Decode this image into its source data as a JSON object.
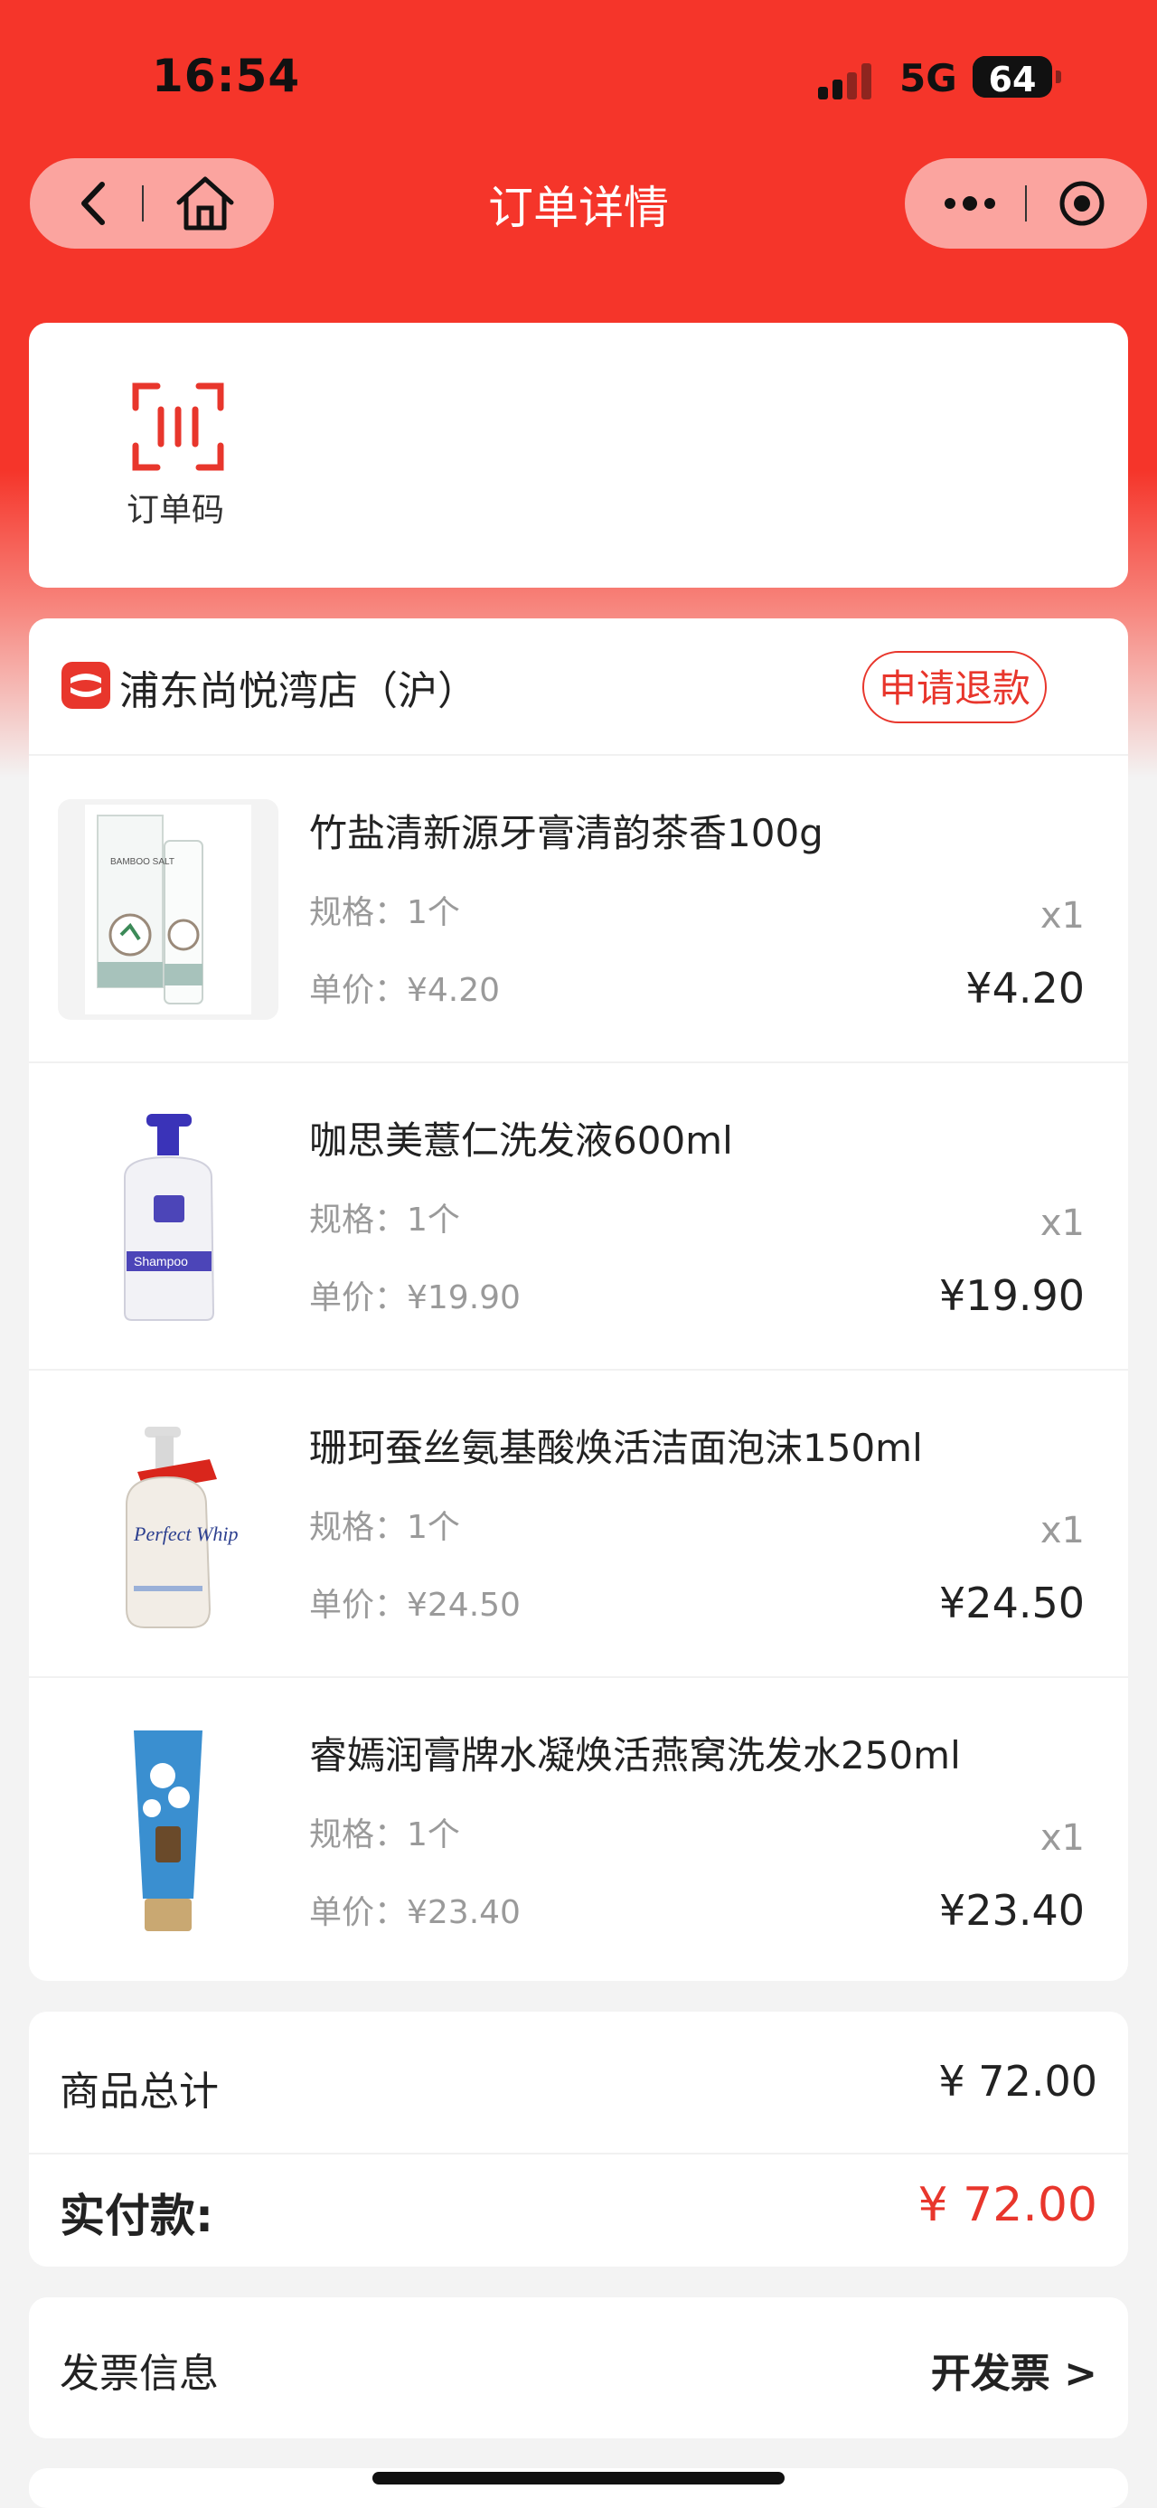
{
  "status_bar": {
    "time": "16:54",
    "network": "5G",
    "battery": "64"
  },
  "nav": {
    "title": "订单详情"
  },
  "order_code": {
    "label": "订单码"
  },
  "store": {
    "name": "浦东尚悦湾店（沪）",
    "refund_label": "申请退款"
  },
  "items": [
    {
      "name": "竹盐清新源牙膏清韵茶香100g",
      "spec": "规格：1个",
      "unit_price": "单价：¥4.20",
      "qty": "x1",
      "price": "¥4.20"
    },
    {
      "name": "咖思美薏仁洗发液600ml",
      "spec": "规格：1个",
      "unit_price": "单价：¥19.90",
      "qty": "x1",
      "price": "¥19.90"
    },
    {
      "name": "珊珂蚕丝氨基酸焕活洁面泡沫150ml",
      "spec": "规格：1个",
      "unit_price": "单价：¥24.50",
      "qty": "x1",
      "price": "¥24.50"
    },
    {
      "name": "睿嫣润膏牌水凝焕活燕窝洗发水250ml",
      "spec": "规格：1个",
      "unit_price": "单价：¥23.40",
      "qty": "x1",
      "price": "¥23.40"
    }
  ],
  "summary": {
    "goods_total_label": "商品总计",
    "goods_total_value": "¥ 72.00",
    "paid_label": "实付款:",
    "paid_value": "¥ 72.00"
  },
  "invoice": {
    "label": "发票信息",
    "action": "开发票 >"
  },
  "product_labels": {
    "toothpaste_brand": "BAMBOO SALT",
    "shampoo_brand": "Shampoo",
    "whip_brand": "Perfect Whip"
  },
  "colors": {
    "accent": "#e8362c",
    "header_red": "#f5352a",
    "page_bg": "#f3f3f3"
  }
}
